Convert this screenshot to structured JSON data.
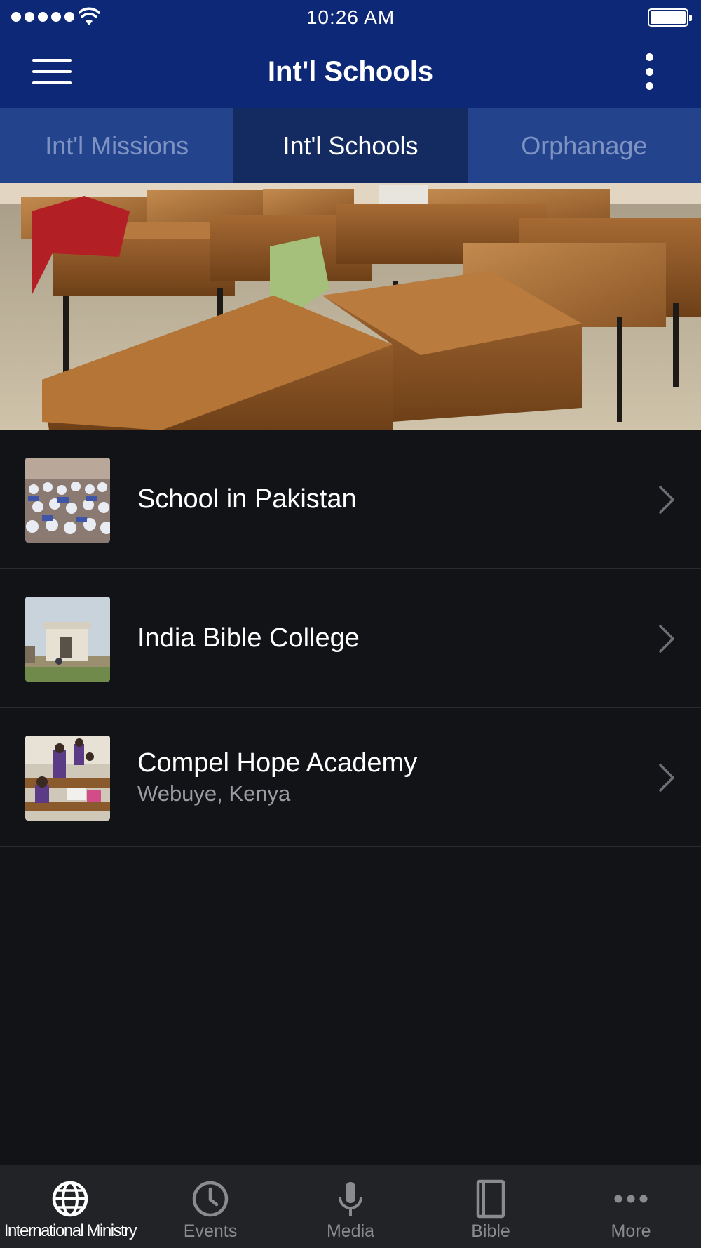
{
  "status_bar": {
    "time": "10:26 AM"
  },
  "nav_bar": {
    "title": "Int'l Schools"
  },
  "tabs": [
    {
      "label": "Int'l Missions",
      "active": false
    },
    {
      "label": "Int'l Schools",
      "active": true
    },
    {
      "label": "Orphanage",
      "active": false
    }
  ],
  "list": [
    {
      "title": "School in Pakistan",
      "subtitle": ""
    },
    {
      "title": "India Bible College",
      "subtitle": ""
    },
    {
      "title": "Compel Hope Academy",
      "subtitle": "Webuye, Kenya"
    }
  ],
  "tab_bar": [
    {
      "label": "International Ministry",
      "icon": "globe-icon",
      "active": true
    },
    {
      "label": "Events",
      "icon": "clock-icon",
      "active": false
    },
    {
      "label": "Media",
      "icon": "microphone-icon",
      "active": false
    },
    {
      "label": "Bible",
      "icon": "book-icon",
      "active": false
    },
    {
      "label": "More",
      "icon": "more-icon",
      "active": false
    }
  ],
  "colors": {
    "header": "#0c2877",
    "tab_strip": "#23448d",
    "tab_active": "#142b62",
    "background": "#121316",
    "tab_bar": "#222326"
  }
}
